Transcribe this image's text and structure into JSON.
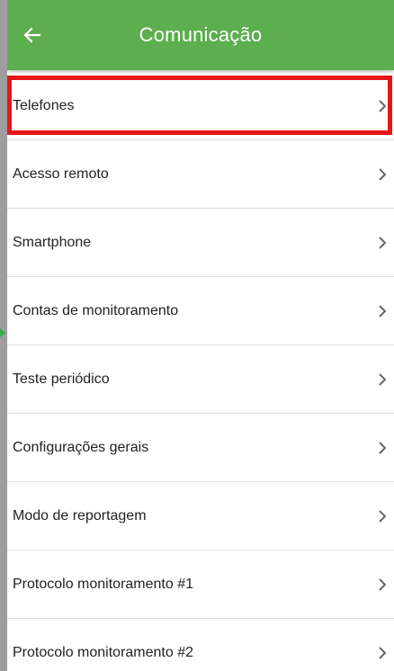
{
  "app_bar": {
    "title": "Comunicação",
    "back_icon": "arrow-left-icon",
    "color": "#5cae4f"
  },
  "highlight_color": "#e8141a",
  "menu": {
    "items": [
      {
        "label": "Telefones",
        "highlighted": true
      },
      {
        "label": "Acesso remoto"
      },
      {
        "label": "Smartphone"
      },
      {
        "label": "Contas de monitoramento"
      },
      {
        "label": "Teste periódico"
      },
      {
        "label": "Configurações gerais"
      },
      {
        "label": "Modo de reportagem"
      },
      {
        "label": "Protocolo monitoramento #1"
      },
      {
        "label": "Protocolo monitoramento #2"
      }
    ],
    "chevron_icon": "chevron-right-icon"
  }
}
